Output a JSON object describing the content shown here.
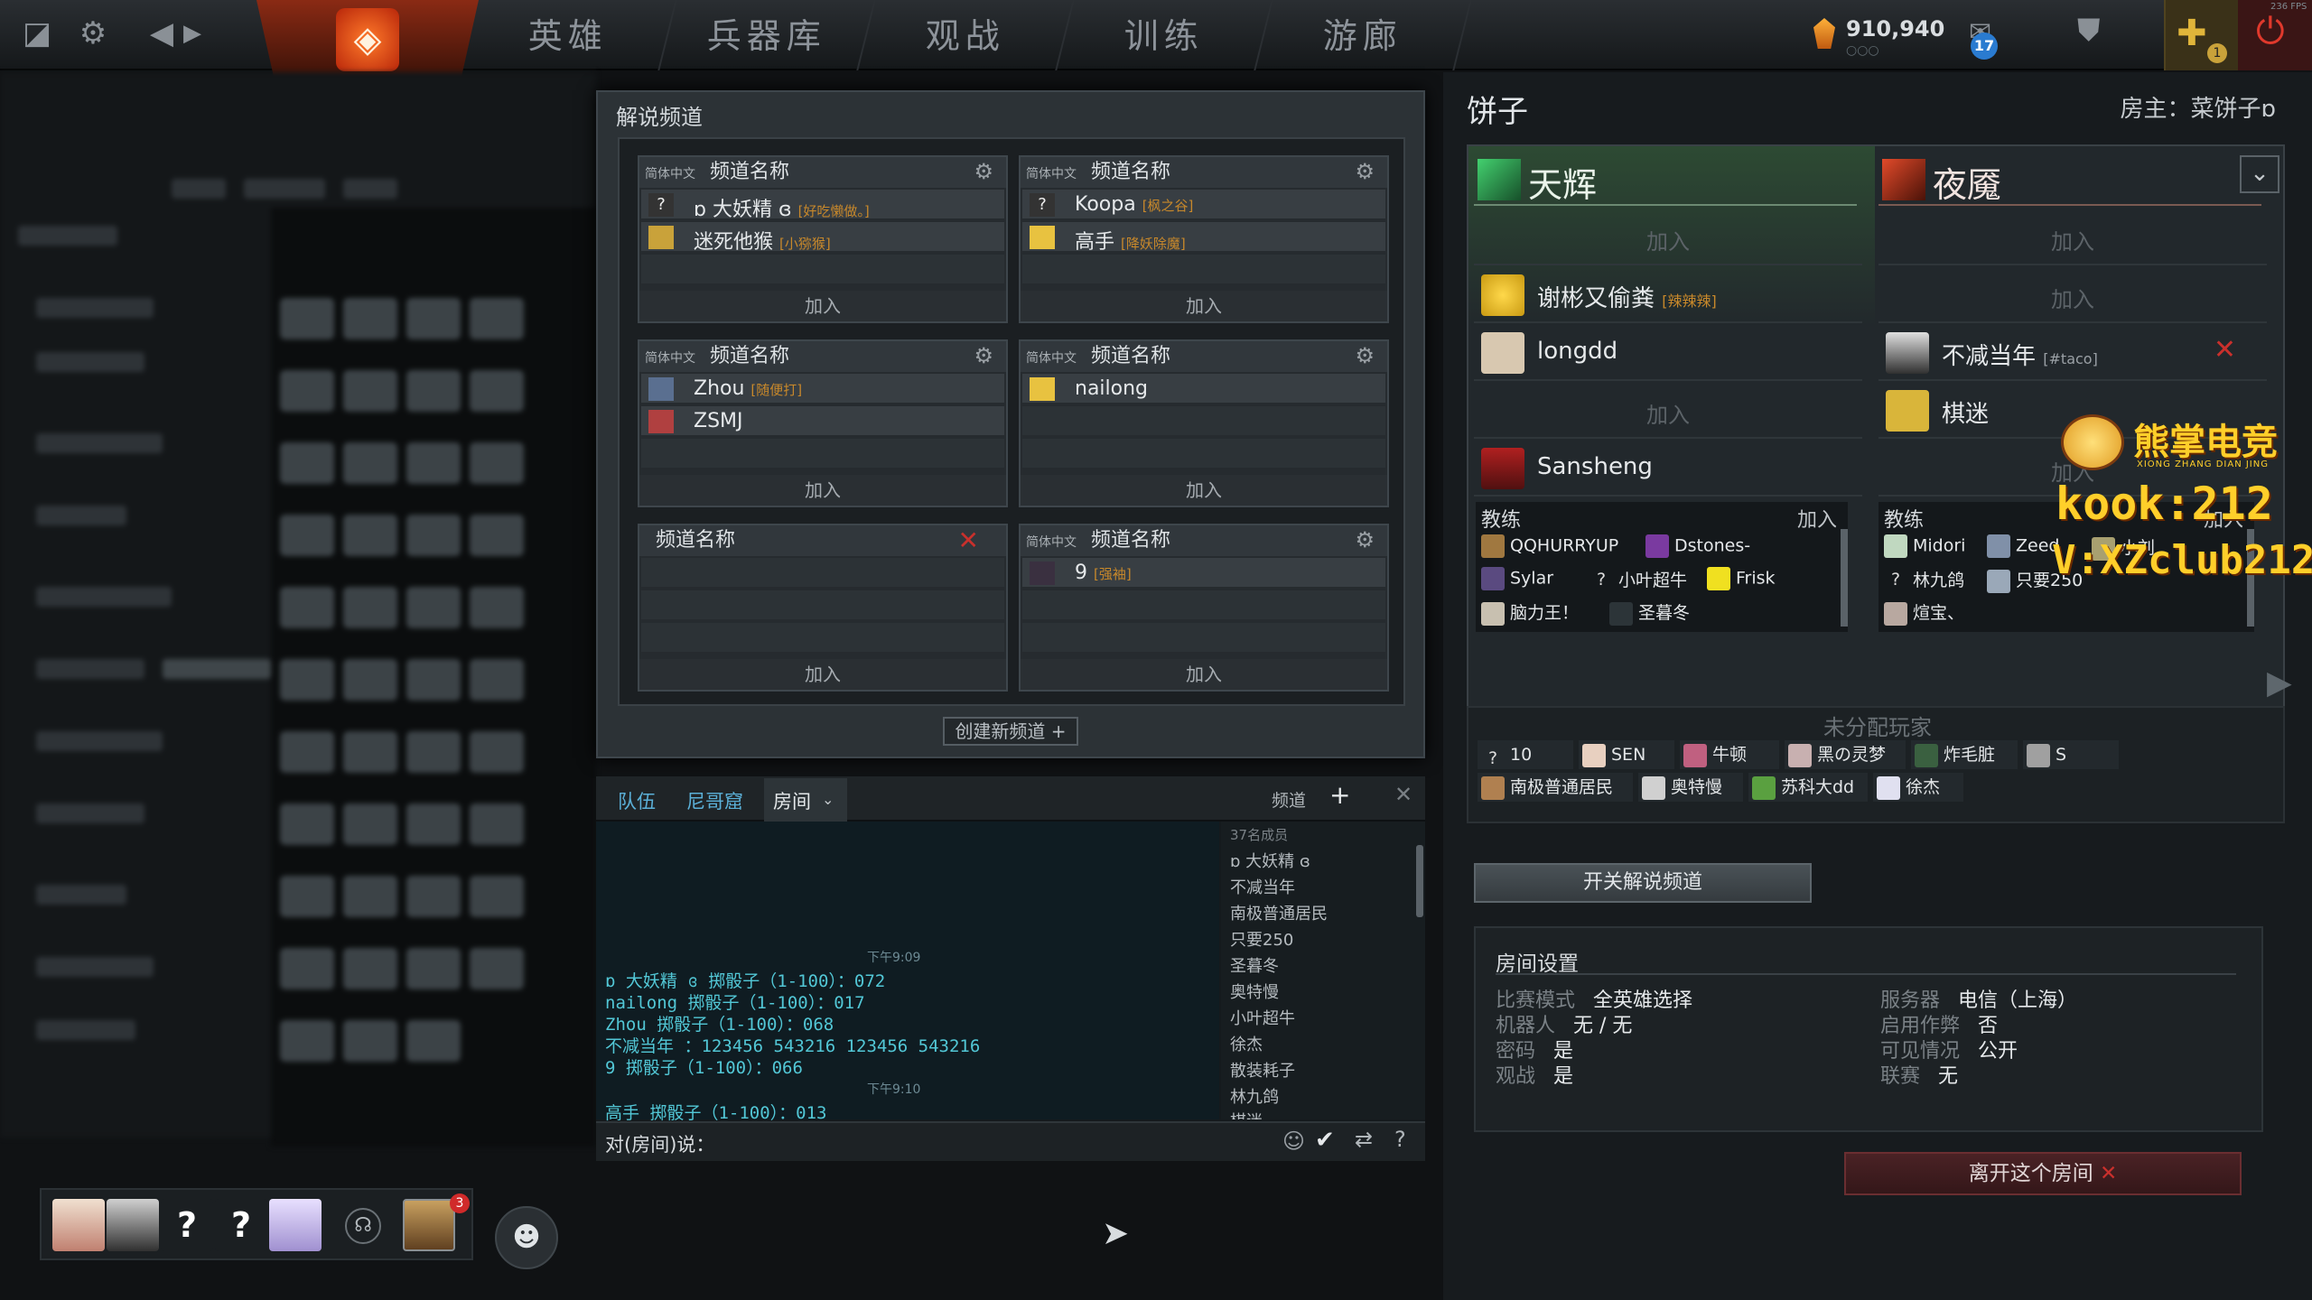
{
  "topbar": {
    "tabs": [
      "英雄",
      "兵器库",
      "观战",
      "训练",
      "游廊"
    ],
    "shards": "910,940",
    "mail_count": "17",
    "plus_count": "1",
    "fps": "236 FPS"
  },
  "broadcast": {
    "title": "解说频道",
    "channels": [
      {
        "lang": "简体中文",
        "name": "频道名称",
        "members": [
          {
            "name": "ɒ 大妖精 ɞ",
            "tag": "[好吃懒做。]",
            "avatar": "?"
          },
          {
            "name": "迷死他猴",
            "tag": "[小猕猴]",
            "avatar": ""
          }
        ],
        "join": "加入"
      },
      {
        "lang": "简体中文",
        "name": "频道名称",
        "members": [
          {
            "name": "Koopa",
            "tag": "[枫之谷]",
            "avatar": "?"
          },
          {
            "name": "高手",
            "tag": "[降妖除魔]",
            "avatar": ""
          }
        ],
        "join": "加入"
      },
      {
        "lang": "简体中文",
        "name": "频道名称",
        "members": [
          {
            "name": "Zhou",
            "tag": "[随便打]",
            "avatar": ""
          },
          {
            "name": "ZSMJ",
            "tag": "",
            "avatar": ""
          }
        ],
        "join": "加入"
      },
      {
        "lang": "简体中文",
        "name": "频道名称",
        "members": [
          {
            "name": "nailong",
            "tag": "",
            "avatar": ""
          }
        ],
        "join": "加入"
      },
      {
        "lang": "",
        "name": "频道名称",
        "members": [],
        "join": "加入"
      },
      {
        "lang": "简体中文",
        "name": "频道名称",
        "members": [
          {
            "name": "9",
            "tag": "[强袖]",
            "avatar": ""
          }
        ],
        "join": "加入"
      }
    ],
    "new_channel": "创建新频道"
  },
  "chat": {
    "tabs": [
      "队伍",
      "尼哥窟",
      "房间"
    ],
    "channel_label": "频道",
    "time1": "下午9:09",
    "time2": "下午9:10",
    "lines": [
      "ɒ 大妖精 ɞ 掷骰子（1-100）：072",
      "nailong 掷骰子（1-100）：017",
      "Zhou 掷骰子（1-100）：068",
      "不减当年 ：123456 543216 123456 543216",
      "9 掷骰子（1-100）：066",
      "高手 掷骰子（1-100）：013"
    ],
    "member_count": "37名成员",
    "members": [
      "ɒ 大妖精 ɞ",
      "不减当年",
      "南极普通居民",
      "只要250",
      "圣暮冬",
      "奥特慢",
      "小叶超牛",
      "徐杰",
      "散装耗子",
      "林九鸽",
      "棋迷"
    ],
    "input_prefix": "对(房间)说："
  },
  "lobby": {
    "title": "饼子",
    "host": "房主：菜饼子ɒ",
    "radiant": {
      "name": "天辉"
    },
    "dire": {
      "name": "夜魇"
    },
    "join": "加入",
    "radiant_slots": [
      {
        "name": "",
        "tag": ""
      },
      {
        "name": "谢彬又偷粪",
        "tag": "[辣辣辣]"
      },
      {
        "name": "longdd",
        "tag": ""
      },
      {
        "name": "",
        "tag": ""
      },
      {
        "name": "Sansheng",
        "tag": ""
      }
    ],
    "dire_slots": [
      {
        "name": "",
        "tag": ""
      },
      {
        "name": "",
        "tag": ""
      },
      {
        "name": "不减当年",
        "tag": "[#taco]"
      },
      {
        "name": "棋迷",
        "tag": ""
      },
      {
        "name": "",
        "tag": ""
      }
    ],
    "coach_label": "教练",
    "radiant_coaches": [
      "QQHURRYUP",
      "Dstones-",
      "Sylar",
      "小叶超牛",
      "Frisk",
      "脑力王！",
      "圣暮冬"
    ],
    "dire_coaches": [
      "Midori",
      "Zeed",
      "小刘",
      "林九鸽",
      "只要250",
      "煊宝、"
    ],
    "unassigned_title": "未分配玩家",
    "unassigned": [
      "10",
      "SEN",
      "牛顿",
      "黑の灵梦",
      "炸毛脏",
      "S",
      "南极普通居民",
      "奥特慢",
      "苏科大dd",
      "徐杰"
    ],
    "broadcast_toggle": "开关解说频道",
    "settings_title": "房间设置",
    "settings": [
      {
        "k": "比赛模式",
        "v": "全英雄选择"
      },
      {
        "k": "机器人",
        "v": "无 / 无"
      },
      {
        "k": "密码",
        "v": "是"
      },
      {
        "k": "观战",
        "v": "是"
      },
      {
        "k": "服务器",
        "v": "电信（上海）"
      },
      {
        "k": "启用作弊",
        "v": "否"
      },
      {
        "k": "可见情况",
        "v": "公开"
      },
      {
        "k": "联赛",
        "v": "无"
      }
    ],
    "leave": "离开这个房间"
  },
  "watermark": {
    "brand": "熊掌电竞",
    "sub": "XIONG ZHANG DIAN JING",
    "kook": "kook:212",
    "vx": "V:XZclub212"
  },
  "party": {
    "notif": "3"
  }
}
